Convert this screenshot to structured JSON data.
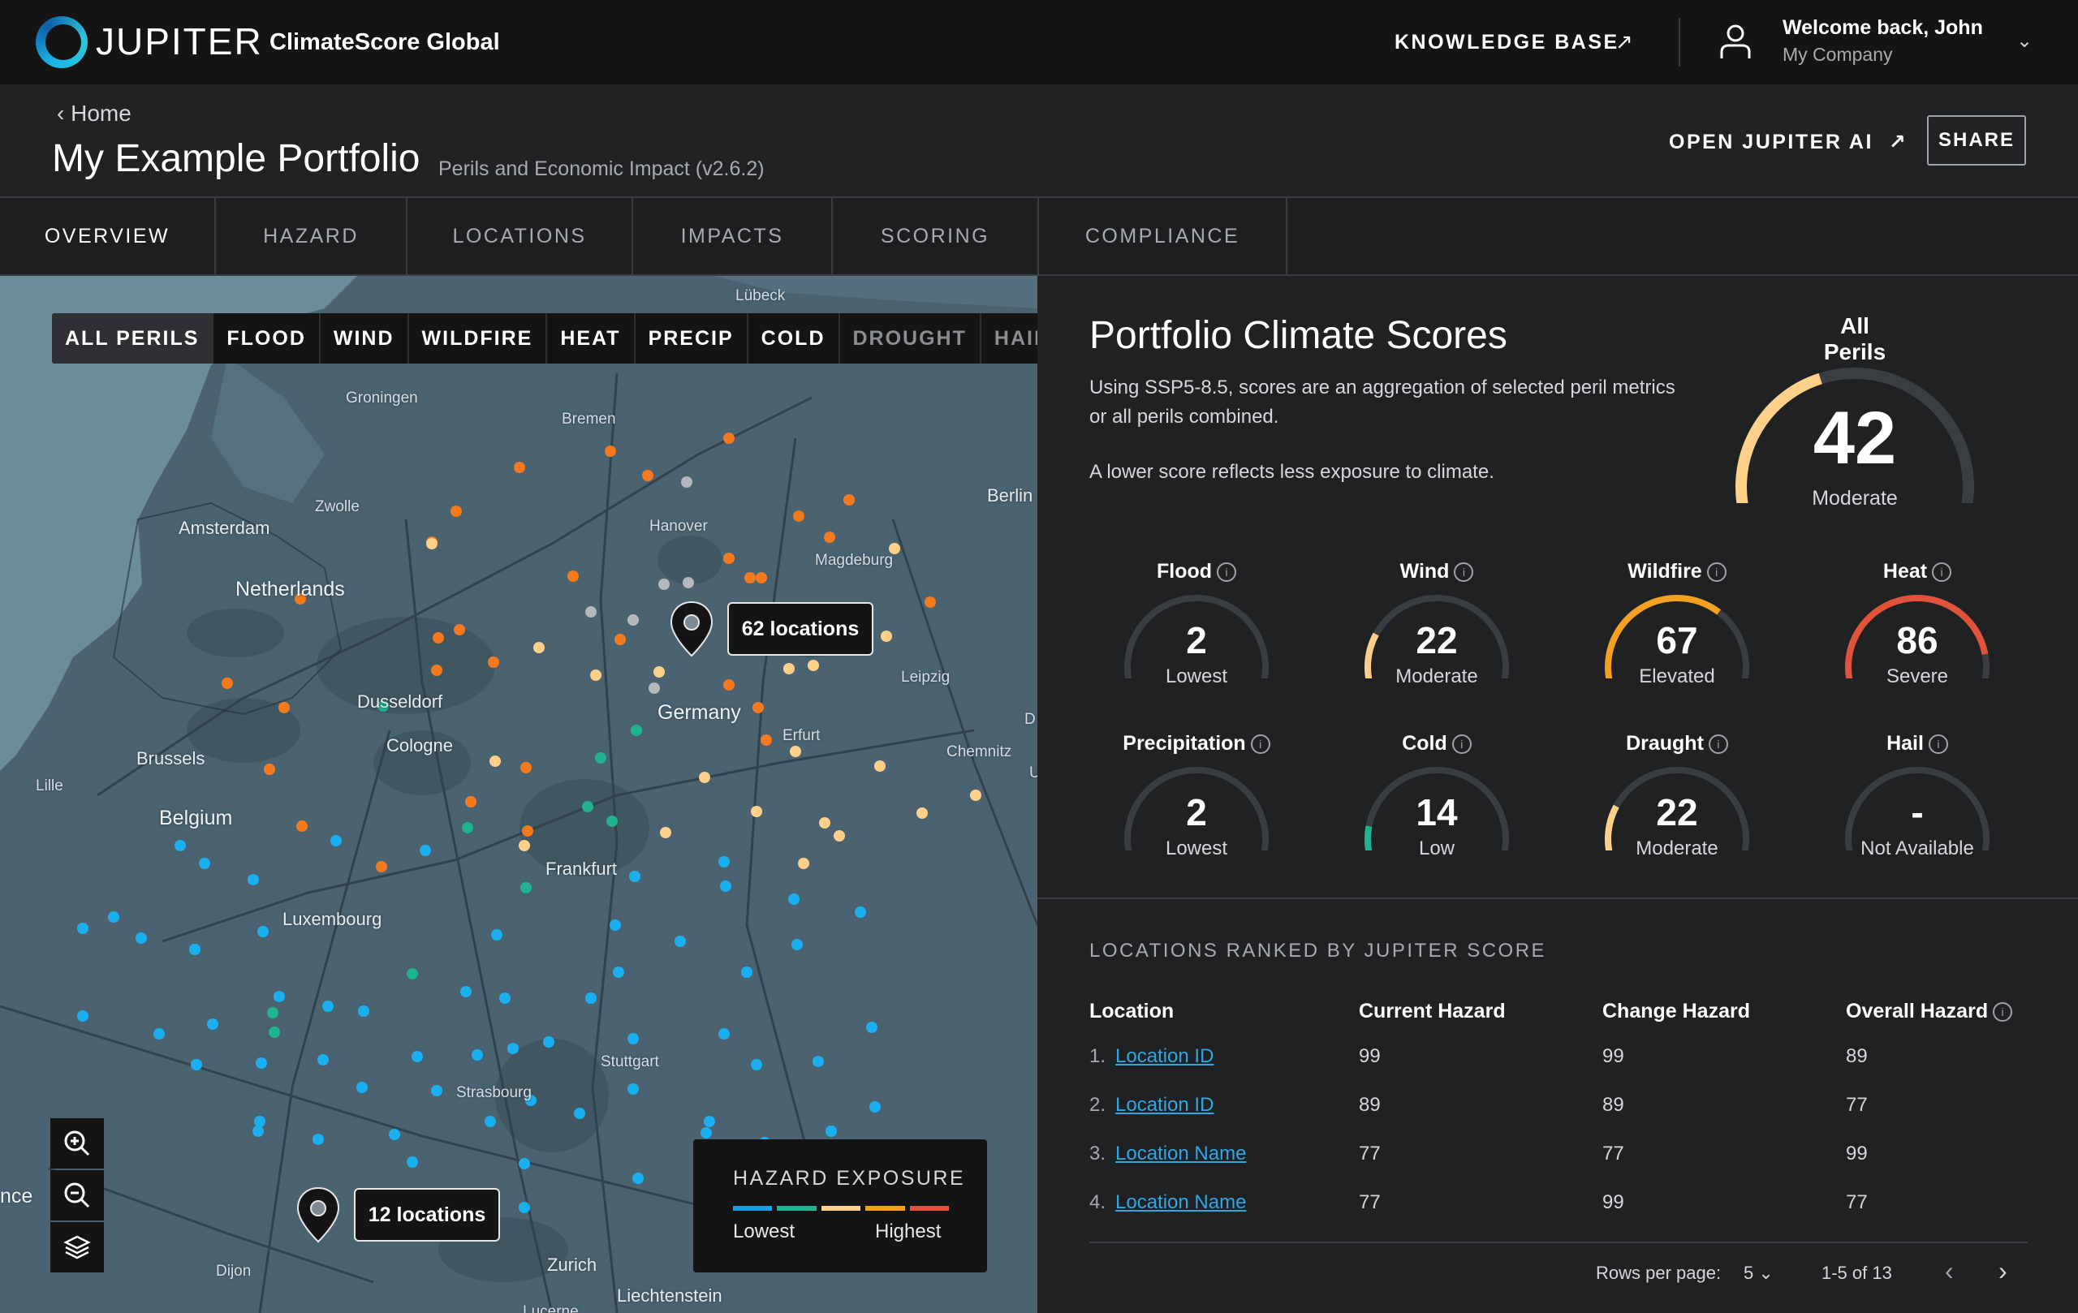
{
  "topbar": {
    "brand": "JUPITER",
    "product": "ClimateScore Global",
    "knowledge_base": "KNOWLEDGE BASE",
    "welcome": "Welcome back, John",
    "company": "My Company"
  },
  "header": {
    "back": "Home",
    "title": "My Example Portfolio",
    "subtitle": "Perils and Economic Impact (v2.6.2)",
    "open_ai": "OPEN JUPITER AI",
    "share": "SHARE"
  },
  "tabs": [
    {
      "label": "OVERVIEW",
      "active": true
    },
    {
      "label": "HAZARD"
    },
    {
      "label": "LOCATIONS"
    },
    {
      "label": "IMPACTS"
    },
    {
      "label": "SCORING"
    },
    {
      "label": "COMPLIANCE"
    }
  ],
  "map": {
    "perils": [
      "ALL PERILS",
      "FLOOD",
      "WIND",
      "WILDFIRE",
      "HEAT",
      "PRECIP",
      "COLD",
      "DROUGHT",
      "HAIL"
    ],
    "labels": {
      "lubeck": "Lübeck",
      "groningen": "Groningen",
      "bremen": "Bremen",
      "berlin": "Berlin",
      "amsterdam": "Amsterdam",
      "zwolle": "Zwolle",
      "hanover": "Hanover",
      "magdeburg": "Magdeburg",
      "netherlands": "Netherlands",
      "leipzig": "Leipzig",
      "dusseldorf": "Dusseldorf",
      "germany": "Germany",
      "cologne": "Cologne",
      "erfurt": "Erfurt",
      "chemnitz": "Chemnitz",
      "brussels": "Brussels",
      "lille": "Lille",
      "belgium": "Belgium",
      "frankfurt": "Frankfurt",
      "luxembourg": "Luxembourg",
      "stuttgart": "Stuttgart",
      "strasbourg": "Strasbourg",
      "france": "nce",
      "dijon": "Dijon",
      "zurich": "Zurich",
      "liechtenstein": "Liechtenstein",
      "lucerne": "Lucerne",
      "d_edge": "D",
      "u_edge": "U"
    },
    "clusters": [
      {
        "label": "62 locations"
      },
      {
        "label": "12 locations"
      }
    ],
    "legend": {
      "title": "HAZARD EXPOSURE",
      "low": "Lowest",
      "high": "Highest",
      "colors": [
        "#1a9be0",
        "#1fb38f",
        "#ffd08a",
        "#f5a020",
        "#e0523a"
      ]
    }
  },
  "scores": {
    "title": "Portfolio Climate Scores",
    "description": "Using SSP5-8.5, scores are an aggregation of selected peril metrics or all perils combined.",
    "note": "A lower score reflects less exposure to climate.",
    "overall": {
      "label": "All Perils",
      "value": 42,
      "display": "42",
      "level": "Moderate",
      "color": "#ffd08a"
    },
    "perils": [
      {
        "name": "Flood",
        "value": 2,
        "display": "2",
        "level": "Lowest",
        "color": "#1a9be0"
      },
      {
        "name": "Wind",
        "value": 22,
        "display": "22",
        "level": "Moderate",
        "color": "#ffd08a"
      },
      {
        "name": "Wildfire",
        "value": 67,
        "display": "67",
        "level": "Elevated",
        "color": "#f5a020"
      },
      {
        "name": "Heat",
        "value": 86,
        "display": "86",
        "level": "Severe",
        "color": "#e0523a"
      },
      {
        "name": "Precipitation",
        "value": 2,
        "display": "2",
        "level": "Lowest",
        "color": "#1a9be0"
      },
      {
        "name": "Cold",
        "value": 14,
        "display": "14",
        "level": "Low",
        "color": "#1fb38f"
      },
      {
        "name": "Draught",
        "value": 22,
        "display": "22",
        "level": "Moderate",
        "color": "#ffd08a"
      },
      {
        "name": "Hail",
        "value": 0,
        "display": "-",
        "level": "Not Available",
        "color": "#1fb38f"
      }
    ]
  },
  "ranked": {
    "title": "LOCATIONS RANKED BY JUPITER SCORE",
    "columns": [
      "Location",
      "Current Hazard",
      "Change Hazard",
      "Overall Hazard"
    ],
    "rows": [
      {
        "num": "1.",
        "name": "Location ID",
        "current": "99",
        "change": "99",
        "overall": "89"
      },
      {
        "num": "2.",
        "name": "Location ID",
        "current": "89",
        "change": "89",
        "overall": "77"
      },
      {
        "num": "3.",
        "name": "Location Name",
        "current": "77",
        "change": "77",
        "overall": "99"
      },
      {
        "num": "4.",
        "name": "Location Name",
        "current": "77",
        "change": "99",
        "overall": "77"
      }
    ],
    "pagination": {
      "rows_per_page_label": "Rows per page:",
      "rows_per_page": "5",
      "range": "1-5 of 13"
    }
  }
}
